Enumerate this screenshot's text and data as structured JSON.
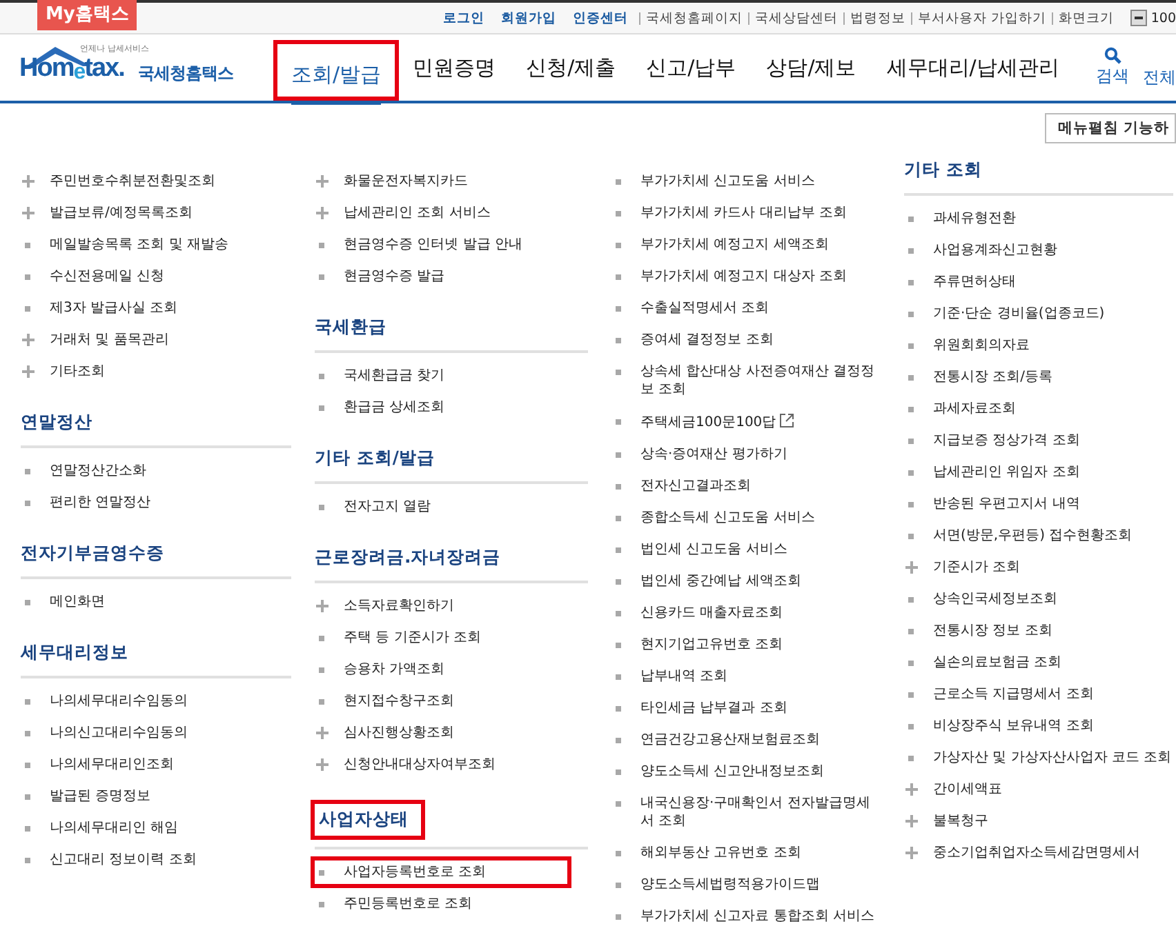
{
  "top_bar": {
    "badge": "My홈택스",
    "links": [
      {
        "label": "로그인",
        "kind": "primary"
      },
      {
        "label": "회원가입",
        "kind": "primary"
      },
      {
        "label": "인증센터",
        "kind": "primary"
      },
      {
        "label": "국세청홈페이지",
        "kind": "secondary"
      },
      {
        "label": "국세상담센터",
        "kind": "secondary"
      },
      {
        "label": "법령정보",
        "kind": "secondary"
      },
      {
        "label": "부서사용자 가입하기",
        "kind": "secondary"
      }
    ],
    "zoom": {
      "label": "화면크기",
      "value": "100"
    }
  },
  "header": {
    "logo": {
      "tagline": "언제나 납세서비스",
      "name": "Hom$_{e}$tax.",
      "subtitle": "국세청홈택스"
    },
    "tabs": [
      {
        "label": "조회/발급",
        "selected": true,
        "boxed": true
      },
      {
        "label": "민원증명",
        "selected": false,
        "boxed": false
      },
      {
        "label": "신청/제출",
        "selected": false,
        "boxed": false
      },
      {
        "label": "신고/납부",
        "selected": false,
        "boxed": false
      },
      {
        "label": "상담/제보",
        "selected": false,
        "boxed": false
      },
      {
        "label": "세무대리/납세관리",
        "selected": false,
        "boxed": false
      }
    ],
    "search": "검색",
    "all_menu": "전체"
  },
  "expand_button": "메뉴펼침 기능하",
  "columns": [
    [
      {
        "items": [
          {
            "label": "주민번호수취분전환및조회",
            "kind": "plus"
          },
          {
            "label": "발급보류/예정목록조회",
            "kind": "plus"
          },
          {
            "label": "메일발송목록 조회 및 재발송",
            "kind": "square"
          },
          {
            "label": "수신전용메일 신청",
            "kind": "square"
          },
          {
            "label": "제3자 발급사실 조회",
            "kind": "square"
          },
          {
            "label": "거래처 및 품목관리",
            "kind": "plus"
          },
          {
            "label": "기타조회",
            "kind": "plus"
          }
        ]
      },
      {
        "heading": "연말정산",
        "boxed": false,
        "items": [
          {
            "label": "연말정산간소화",
            "kind": "square"
          },
          {
            "label": "편리한 연말정산",
            "kind": "square"
          }
        ]
      },
      {
        "heading": "전자기부금영수증",
        "boxed": false,
        "items": [
          {
            "label": "메인화면",
            "kind": "square"
          }
        ]
      },
      {
        "heading": "세무대리정보",
        "boxed": false,
        "items": [
          {
            "label": "나의세무대리수임동의",
            "kind": "square"
          },
          {
            "label": "나의신고대리수임동의",
            "kind": "square"
          },
          {
            "label": "나의세무대리인조회",
            "kind": "square"
          },
          {
            "label": "발급된 증명정보",
            "kind": "square"
          },
          {
            "label": "나의세무대리인 해임",
            "kind": "square"
          },
          {
            "label": "신고대리 정보이력 조회",
            "kind": "square"
          }
        ]
      }
    ],
    [
      {
        "items": [
          {
            "label": "화물운전자복지카드",
            "kind": "plus"
          },
          {
            "label": "납세관리인 조회 서비스",
            "kind": "plus"
          },
          {
            "label": "현금영수증 인터넷 발급 안내",
            "kind": "square"
          },
          {
            "label": "현금영수증 발급",
            "kind": "square"
          }
        ]
      },
      {
        "heading": "국세환급",
        "boxed": false,
        "items": [
          {
            "label": "국세환급금 찾기",
            "kind": "square"
          },
          {
            "label": "환급금 상세조회",
            "kind": "square"
          }
        ]
      },
      {
        "heading": "기타 조회/발급",
        "boxed": false,
        "items": [
          {
            "label": "전자고지 열람",
            "kind": "square"
          }
        ]
      },
      {
        "heading": "근로장려금.자녀장려금",
        "boxed": false,
        "items": [
          {
            "label": "소득자료확인하기",
            "kind": "plus"
          },
          {
            "label": "주택 등 기준시가 조회",
            "kind": "square"
          },
          {
            "label": "승용차 가액조회",
            "kind": "square"
          },
          {
            "label": "현지접수창구조회",
            "kind": "square"
          },
          {
            "label": "심사진행상황조회",
            "kind": "plus"
          },
          {
            "label": "신청안내대상자여부조회",
            "kind": "plus"
          }
        ]
      },
      {
        "heading": "사업자상태",
        "boxed": true,
        "items": [
          {
            "label": "사업자등록번호로 조회",
            "kind": "square",
            "boxed": true
          },
          {
            "label": "주민등록번호로 조회",
            "kind": "square"
          }
        ]
      }
    ],
    [
      {
        "items": [
          {
            "label": "부가가치세 신고도움 서비스",
            "kind": "square"
          },
          {
            "label": "부가가치세 카드사 대리납부 조회",
            "kind": "square"
          },
          {
            "label": "부가가치세 예정고지 세액조회",
            "kind": "square"
          },
          {
            "label": "부가가치세 예정고지 대상자 조회",
            "kind": "square"
          },
          {
            "label": "수출실적명세서 조회",
            "kind": "square"
          },
          {
            "label": "증여세 결정정보 조회",
            "kind": "square"
          },
          {
            "label": "상속세 합산대상 사전증여재산 결정정보 조회",
            "kind": "square"
          },
          {
            "label": "주택세금100문100답",
            "kind": "square",
            "external": true
          },
          {
            "label": "상속·증여재산 평가하기",
            "kind": "square"
          },
          {
            "label": "전자신고결과조회",
            "kind": "square"
          },
          {
            "label": "종합소득세 신고도움 서비스",
            "kind": "square"
          },
          {
            "label": "법인세 신고도움 서비스",
            "kind": "square"
          },
          {
            "label": "법인세 중간예납 세액조회",
            "kind": "square"
          },
          {
            "label": "신용카드 매출자료조회",
            "kind": "square"
          },
          {
            "label": "현지기업고유번호 조회",
            "kind": "square"
          },
          {
            "label": "납부내역 조회",
            "kind": "square"
          },
          {
            "label": "타인세금 납부결과 조회",
            "kind": "square"
          },
          {
            "label": "연금건강고용산재보험료조회",
            "kind": "square"
          },
          {
            "label": "양도소득세 신고안내정보조회",
            "kind": "square"
          },
          {
            "label": "내국신용장·구매확인서 전자발급명세서 조회",
            "kind": "square"
          },
          {
            "label": "해외부동산 고유번호 조회",
            "kind": "square"
          },
          {
            "label": "양도소득세법령적용가이드맵",
            "kind": "square"
          },
          {
            "label": "부가가치세 신고자료 통합조회 서비스",
            "kind": "square"
          }
        ]
      }
    ],
    [
      {
        "heading": "기타 조회",
        "boxed": false,
        "items": [
          {
            "label": "과세유형전환",
            "kind": "square"
          },
          {
            "label": "사업용계좌신고현황",
            "kind": "square"
          },
          {
            "label": "주류면허상태",
            "kind": "square"
          },
          {
            "label": "기준·단순 경비율(업종코드)",
            "kind": "square"
          },
          {
            "label": "위원회회의자료",
            "kind": "square"
          },
          {
            "label": "전통시장 조회/등록",
            "kind": "square"
          },
          {
            "label": "과세자료조회",
            "kind": "square"
          },
          {
            "label": "지급보증 정상가격 조회",
            "kind": "square"
          },
          {
            "label": "납세관리인 위임자 조회",
            "kind": "square"
          },
          {
            "label": "반송된 우편고지서 내역",
            "kind": "square"
          },
          {
            "label": "서면(방문,우편등) 접수현황조회",
            "kind": "square"
          },
          {
            "label": "기준시가 조회",
            "kind": "plus"
          },
          {
            "label": "상속인국세정보조회",
            "kind": "square"
          },
          {
            "label": "전통시장 정보 조회",
            "kind": "square"
          },
          {
            "label": "실손의료보험금 조회",
            "kind": "square"
          },
          {
            "label": "근로소득 지급명세서 조회",
            "kind": "square"
          },
          {
            "label": "비상장주식 보유내역 조회",
            "kind": "square"
          },
          {
            "label": "가상자산 및 가상자산사업자 코드 조회",
            "kind": "square"
          },
          {
            "label": "간이세액표",
            "kind": "plus"
          },
          {
            "label": "불복청구",
            "kind": "plus"
          },
          {
            "label": "중소기업취업자소득세감면명세서",
            "kind": "plus"
          }
        ]
      }
    ]
  ]
}
